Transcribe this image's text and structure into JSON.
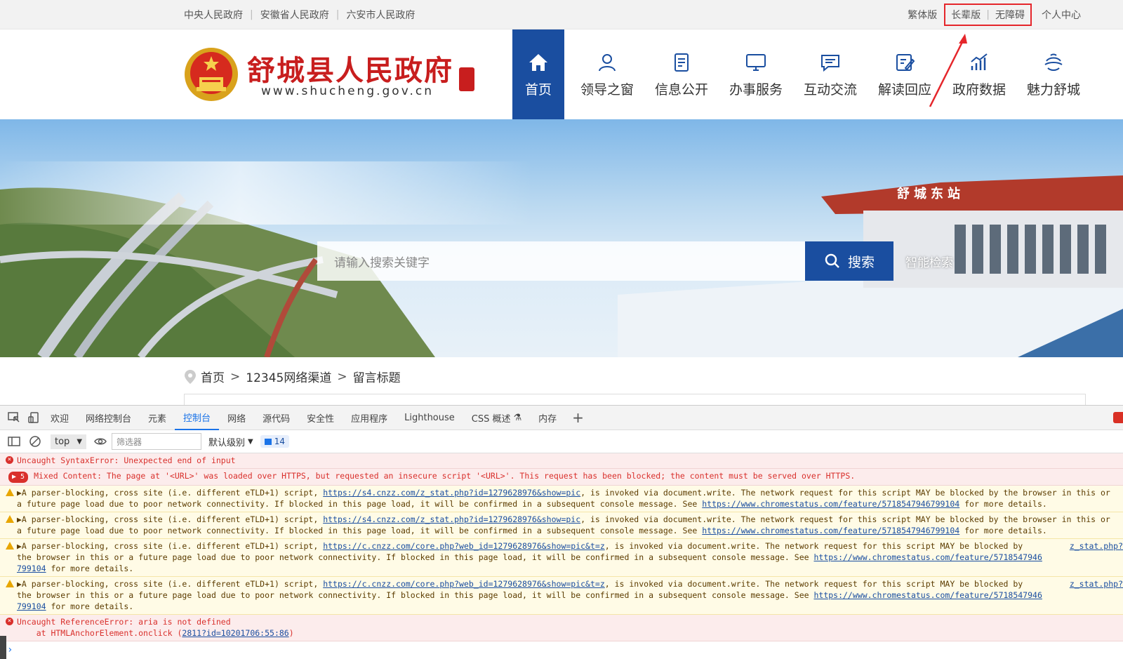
{
  "topbar": {
    "links": [
      "中央人民政府",
      "安徽省人民政府",
      "六安市人民政府"
    ],
    "traditional": "繁体版",
    "elder": "长辈版",
    "accessible": "无障碍",
    "personal": "个人中心"
  },
  "header": {
    "site_name": "舒城县人民政府",
    "site_url": "www.shucheng.gov.cn",
    "nav": [
      {
        "label": "首页",
        "icon": "home-icon"
      },
      {
        "label": "领导之窗",
        "icon": "person-icon"
      },
      {
        "label": "信息公开",
        "icon": "document-icon"
      },
      {
        "label": "办事服务",
        "icon": "monitor-icon"
      },
      {
        "label": "互动交流",
        "icon": "chat-icon"
      },
      {
        "label": "解读回应",
        "icon": "edit-icon"
      },
      {
        "label": "政府数据",
        "icon": "chart-icon"
      },
      {
        "label": "魅力舒城",
        "icon": "scenery-icon"
      }
    ],
    "station_sign": "舒城东站"
  },
  "search": {
    "placeholder": "请输入搜索关键字",
    "button": "搜索",
    "smart": "智能检索"
  },
  "breadcrumb": {
    "home": "首页",
    "channel": "12345网络渠道",
    "current": "留言标题"
  },
  "devtools": {
    "tabs": [
      "欢迎",
      "网络控制台",
      "元素",
      "控制台",
      "网络",
      "源代码",
      "安全性",
      "应用程序",
      "Lighthouse",
      "CSS 概述",
      "内存"
    ],
    "active_tab": "控制台",
    "context": "top",
    "filter_placeholder": "筛选器",
    "level": "默认级别",
    "count": "14",
    "messages": {
      "m1": "Uncaught SyntaxError: Unexpected end of input",
      "m2_count": "5",
      "m2": "Mixed Content: The page at '<URL>' was loaded over HTTPS, but requested an insecure script '<URL>'. This request has been blocked; the content must be served over HTTPS.",
      "w1_a": "▶A parser-blocking, cross site (i.e. different eTLD+1) script, ",
      "w1_link": "https://s4.cnzz.com/z_stat.php?id=1279628976&show=pic",
      "w1_b": ", is invoked via document.write. The network request for this script MAY be blocked by the browser in this or",
      "w1_c": "a future page load due to poor network connectivity. If blocked in this page load, it will be confirmed in a subsequent console message. See ",
      "w1_link2": "https://www.chromestatus.com/feature/5718547946799104",
      "w1_d": " for more details.",
      "w3_a": "▶A parser-blocking, cross site (i.e. different eTLD+1) script, ",
      "w3_link": "https://c.cnzz.com/core.php?web_id=1279628976&show=pic&t=z",
      "w3_b": ", is invoked via document.write. The network request for this script MAY be blocked by",
      "w3_c": "the browser in this or a future page load due to poor network connectivity. If blocked in this page load, it will be confirmed in a subsequent console message. See ",
      "w3_link2": "https://www.chromestatus.com/feature/5718547946",
      "w3_link3": "799104",
      "w3_d": " for more details.",
      "w3_src": "z_stat.php?",
      "m_last": "Uncaught ReferenceError: aria is not defined",
      "m_last_at": "    at HTMLAnchorElement.onclick (",
      "m_last_link": "2811?id=10201706:55:86",
      "m_last_close": ")"
    },
    "prompt": "›"
  }
}
